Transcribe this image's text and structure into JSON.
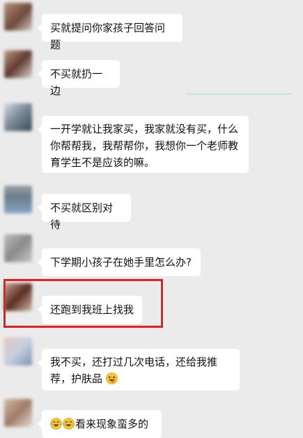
{
  "messages": [
    {
      "text": "买就提问你家孩子回答问题"
    },
    {
      "text": "不买就扔一边"
    },
    {
      "text": "一开学就让我家买，我家就没有买，什么你帮帮我，我帮帮你，我想你一个老师教育学生不是应该的嘛。"
    },
    {
      "text": "不买就区别对待"
    },
    {
      "text": "下学期小孩子在她手里怎么办?"
    },
    {
      "text": "还跑到我班上找我"
    },
    {
      "text": "我不买，还打过几次电话，还给我推荐，护肤品"
    },
    {
      "text": "看来现象蛮多的"
    }
  ],
  "colors": {
    "background": "#ebebeb",
    "bubble": "#ffffff",
    "highlight": "#e41f1f"
  },
  "icons": {
    "msg7_emoji": "grinning-squinting-tongue-emoji",
    "msg8_emoji": "tears-of-joy-emoji"
  }
}
